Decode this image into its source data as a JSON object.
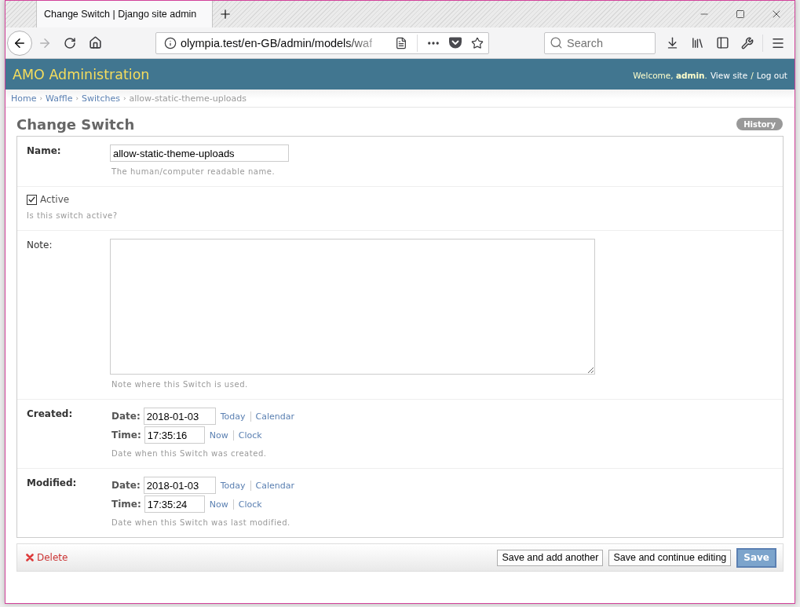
{
  "browser": {
    "tabs": [
      {
        "title": "Change Switch | Django site admin",
        "selected": true
      }
    ],
    "navigation": {
      "back_disabled": false,
      "forward_disabled": true
    },
    "address_bar": {
      "url": "olympia.test/en-GB/admin/models/waf"
    },
    "search": {
      "placeholder": "Search"
    }
  },
  "header": {
    "title": "AMO Administration",
    "greeting": "Welcome, **admin**.",
    "links": [
      "View site",
      "Log out"
    ],
    "separator": "/"
  },
  "breadcrumbs": [
    {
      "kind": "link",
      "label": "Home"
    },
    {
      "kind": "separator",
      "label": "›"
    },
    {
      "kind": "link",
      "label": "Waffle"
    },
    {
      "kind": "separator",
      "label": "›"
    },
    {
      "kind": "link",
      "label": "Switches"
    },
    {
      "kind": "separator",
      "label": "›"
    },
    {
      "kind": "current",
      "label": "allow-static-theme-uploads"
    }
  ],
  "form": {
    "title": "Change Switch",
    "history_button": "History",
    "fields": [
      {
        "kind": "text",
        "label": "Name:",
        "required": true,
        "value": "allow-static-theme-uploads",
        "help": "The human/computer readable name."
      },
      {
        "kind": "checkbox",
        "label": "Active",
        "checked": true,
        "help": "Is this switch active?"
      },
      {
        "kind": "textarea",
        "label": "Note:",
        "required": false,
        "help": "Note where this Switch is used."
      },
      {
        "kind": "datetime",
        "label": "Created:",
        "required": true,
        "date": {
          "label": "Date:",
          "value": "2018-01-03",
          "links": [
            "Today",
            "Calendar"
          ]
        },
        "time": {
          "label": "Time:",
          "value": "17:35:16",
          "links": [
            "Now",
            "Clock"
          ]
        },
        "help": "Date when this Switch was created."
      },
      {
        "kind": "datetime",
        "label": "Modified:",
        "required": true,
        "date": {
          "label": "Date:",
          "value": "2018-01-03",
          "links": [
            "Today",
            "Calendar"
          ]
        },
        "time": {
          "label": "Time:",
          "value": "17:35:24",
          "links": [
            "Now",
            "Clock"
          ]
        },
        "help": "Date when this Switch was last modified."
      }
    ]
  },
  "submit_row": {
    "delete": "Delete",
    "buttons": [
      {
        "label": "Save and add another",
        "default": false
      },
      {
        "label": "Save and continue editing",
        "default": false
      },
      {
        "label": "Save",
        "default": true
      }
    ]
  }
}
